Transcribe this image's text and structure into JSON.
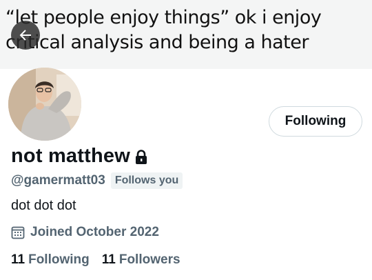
{
  "banner": {
    "text": "“let people enjoy things” ok i enjoy critical analysis and being a hater"
  },
  "profile": {
    "display_name": "not matthew",
    "handle": "@gamermatt03",
    "follows_you_badge": "Follows you",
    "bio": "dot dot dot",
    "joined": "Joined October 2022",
    "following_count": "11",
    "following_label": "Following",
    "followers_count": "11",
    "followers_label": "Followers"
  },
  "actions": {
    "follow_button_label": "Following"
  },
  "icons": {
    "back": "arrow-left-icon",
    "lock": "lock-icon",
    "calendar": "calendar-icon"
  },
  "colors": {
    "primary_text": "#0f1419",
    "secondary_text": "#536471",
    "badge_bg": "#eff3f4",
    "button_border": "#cfd9de"
  }
}
